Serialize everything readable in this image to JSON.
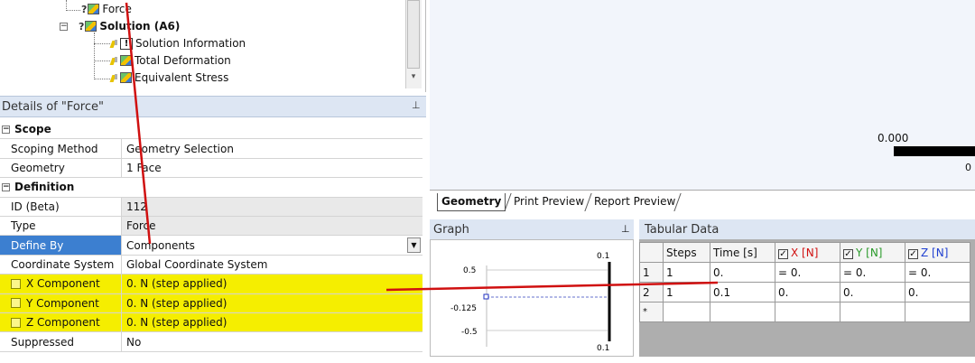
{
  "tree": {
    "items": [
      {
        "label": "Force"
      },
      {
        "label": "Solution (A6)"
      },
      {
        "label": "Solution Information"
      },
      {
        "label": "Total Deformation"
      },
      {
        "label": "Equivalent Stress"
      }
    ]
  },
  "details": {
    "title": "Details of \"Force\"",
    "sections": {
      "scope": "Scope",
      "definition": "Definition"
    },
    "rows": {
      "scoping_method": {
        "label": "Scoping Method",
        "value": "Geometry Selection"
      },
      "geometry": {
        "label": "Geometry",
        "value": "1 Face"
      },
      "id": {
        "label": "ID (Beta)",
        "value": "112"
      },
      "type": {
        "label": "Type",
        "value": "Force"
      },
      "define_by": {
        "label": "Define By",
        "value": "Components"
      },
      "coord_system": {
        "label": "Coordinate System",
        "value": "Global Coordinate System"
      },
      "x_comp": {
        "label": "X Component",
        "value": "0. N  (step applied)"
      },
      "y_comp": {
        "label": "Y Component",
        "value": "0. N  (step applied)"
      },
      "z_comp": {
        "label": "Z Component",
        "value": "0. N  (step applied)"
      },
      "suppressed": {
        "label": "Suppressed",
        "value": "No"
      }
    }
  },
  "viewport": {
    "scale_value": "0.000",
    "scale_zero": "0"
  },
  "tabs": [
    "Geometry",
    "Print Preview",
    "Report Preview"
  ],
  "graph": {
    "title": "Graph",
    "labels": {
      "top_right": "0.1",
      "bottom_right": "0.1",
      "y_high": "0.5",
      "y_mid": "-0.125",
      "y_low": "-0.5"
    }
  },
  "tabular": {
    "title": "Tabular Data",
    "headers": {
      "steps": "Steps",
      "time": "Time [s]",
      "x": "X [N]",
      "y": "Y [N]",
      "z": "Z [N]"
    },
    "rows": [
      {
        "idx": "1",
        "steps": "1",
        "time": "0.",
        "x": "= 0.",
        "y": "= 0.",
        "z": "= 0."
      },
      {
        "idx": "2",
        "steps": "1",
        "time": "0.1",
        "x": "0.",
        "y": "0.",
        "z": "0."
      }
    ],
    "new_row_marker": "*"
  },
  "colors": {
    "highlight_yellow": "#f5ee00",
    "selection_blue": "#3c7fd0",
    "annotation_red": "#d01010",
    "panel_header": "#dde6f3"
  }
}
